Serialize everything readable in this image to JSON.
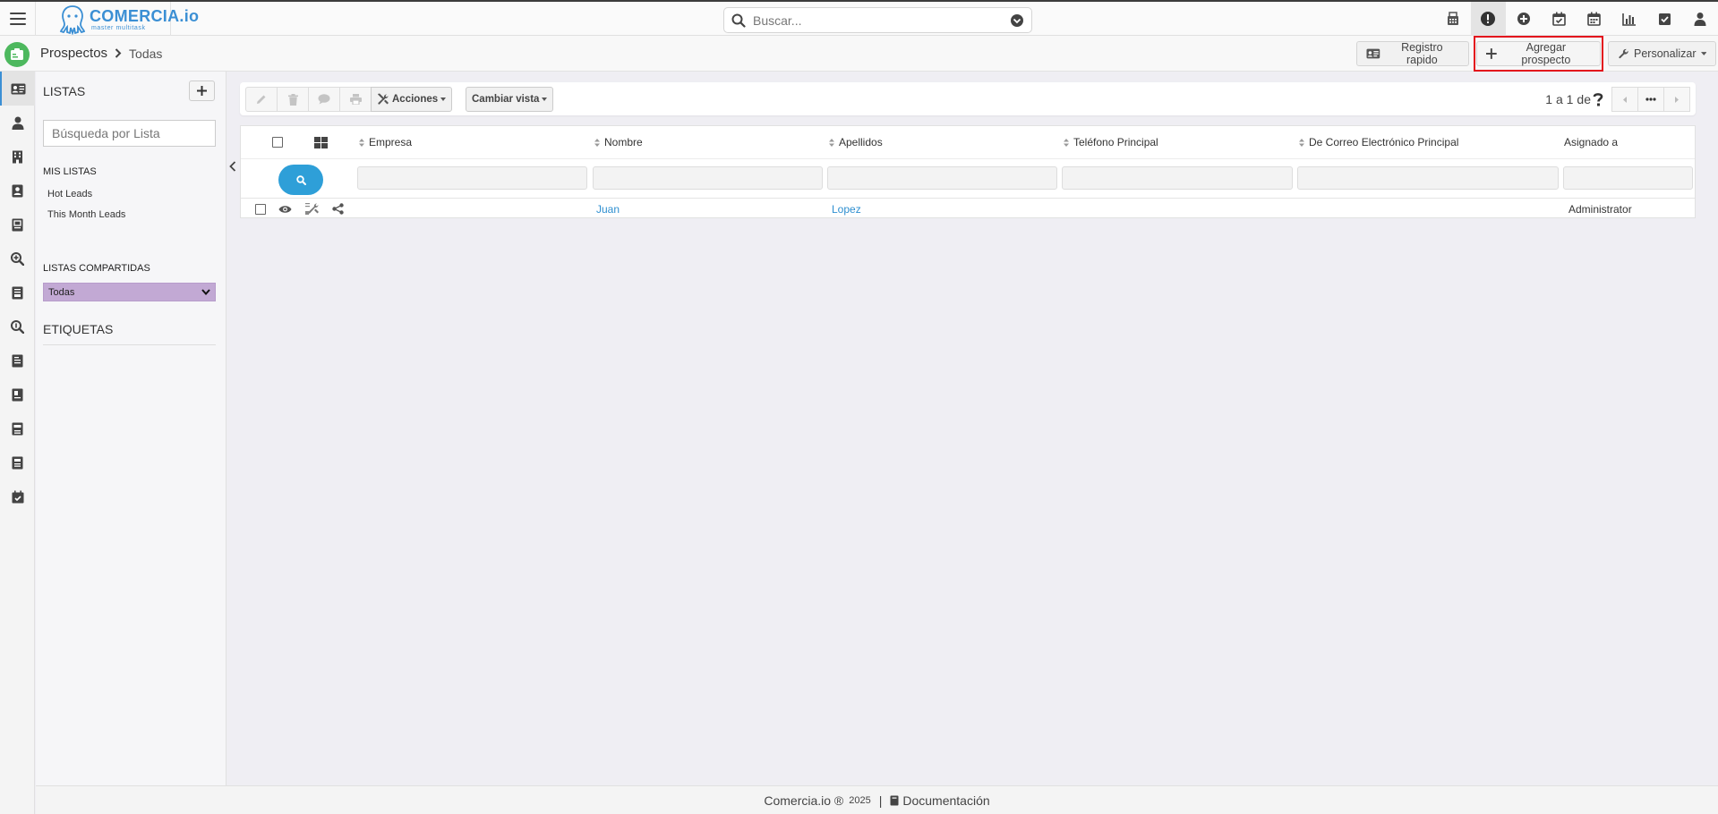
{
  "app": {
    "brand": "COMERCIA.io",
    "tagline": "master multitask",
    "search_placeholder": "Buscar..."
  },
  "top_icons": [
    "calculator-icon",
    "alert-icon",
    "plus-circle-icon",
    "calendar-check-icon",
    "calendar-icon",
    "bar-chart-icon",
    "checkbox-icon",
    "user-icon"
  ],
  "breadcrumb": {
    "module": "Prospectos",
    "view": "Todas"
  },
  "header_buttons": {
    "quick_register": "Registro rapido",
    "add_lead": "Agregar prospecto",
    "customize": "Personalizar"
  },
  "rail_icons": [
    "lead-card-icon",
    "contact-icon",
    "building-icon",
    "account-icon",
    "quote-icon",
    "search-zoom-icon",
    "invoice-icon",
    "search-zoom-icon",
    "book-icon",
    "product-icon",
    "nc-icon",
    "list-icon",
    "calendar-check-icon"
  ],
  "lists_panel": {
    "title": "LISTAS",
    "search_placeholder": "Búsqueda por Lista",
    "my_lists_title": "MIS LISTAS",
    "my_lists": [
      "Hot Leads",
      "This Month Leads"
    ],
    "shared_title": "LISTAS COMPARTIDAS",
    "shared_selected": "Todas",
    "tags_title": "ETIQUETAS"
  },
  "toolbar": {
    "actions_label": "Acciones",
    "change_view_label": "Cambiar vista",
    "pager_text": "1 a 1",
    "pager_of": "de"
  },
  "table": {
    "columns": [
      "Empresa",
      "Nombre",
      "Apellidos",
      "Teléfono Principal",
      "De Correo Electrónico Principal",
      "Asignado a"
    ],
    "rows": [
      {
        "empresa": "",
        "nombre": "Juan",
        "apellidos": "Lopez",
        "telefono": "",
        "correo": "",
        "asignado": "Administrator"
      }
    ]
  },
  "footer": {
    "brand": "Comercia.io ®",
    "year": "2025",
    "separator": "|",
    "doc_label": "Documentación"
  },
  "colors": {
    "accent": "#3b8fd4",
    "module": "#4db85e",
    "shared_select": "#c2a9d4",
    "highlight": "#e3101c"
  }
}
